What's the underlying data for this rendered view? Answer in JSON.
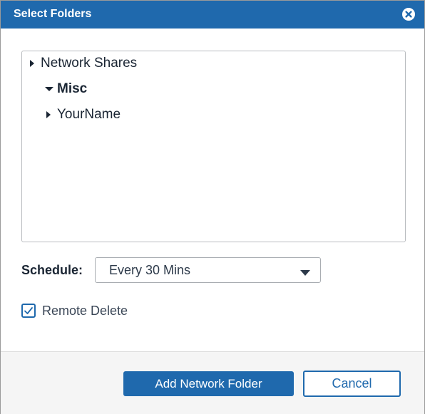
{
  "dialog": {
    "title": "Select Folders",
    "close_icon": "close-circle-icon"
  },
  "tree": {
    "items": [
      {
        "label": "Network Shares",
        "level": 0,
        "expanded": false,
        "bold": false
      },
      {
        "label": "Misc",
        "level": 1,
        "expanded": true,
        "bold": true
      },
      {
        "label": "YourName",
        "level": 1,
        "expanded": false,
        "bold": false
      }
    ]
  },
  "schedule": {
    "label": "Schedule:",
    "value": "Every 30 Mins"
  },
  "remote_delete": {
    "label": "Remote Delete",
    "checked": true
  },
  "footer": {
    "add_label": "Add Network Folder",
    "cancel_label": "Cancel"
  },
  "colors": {
    "accent": "#1f69ad",
    "text": "#1a2533"
  }
}
